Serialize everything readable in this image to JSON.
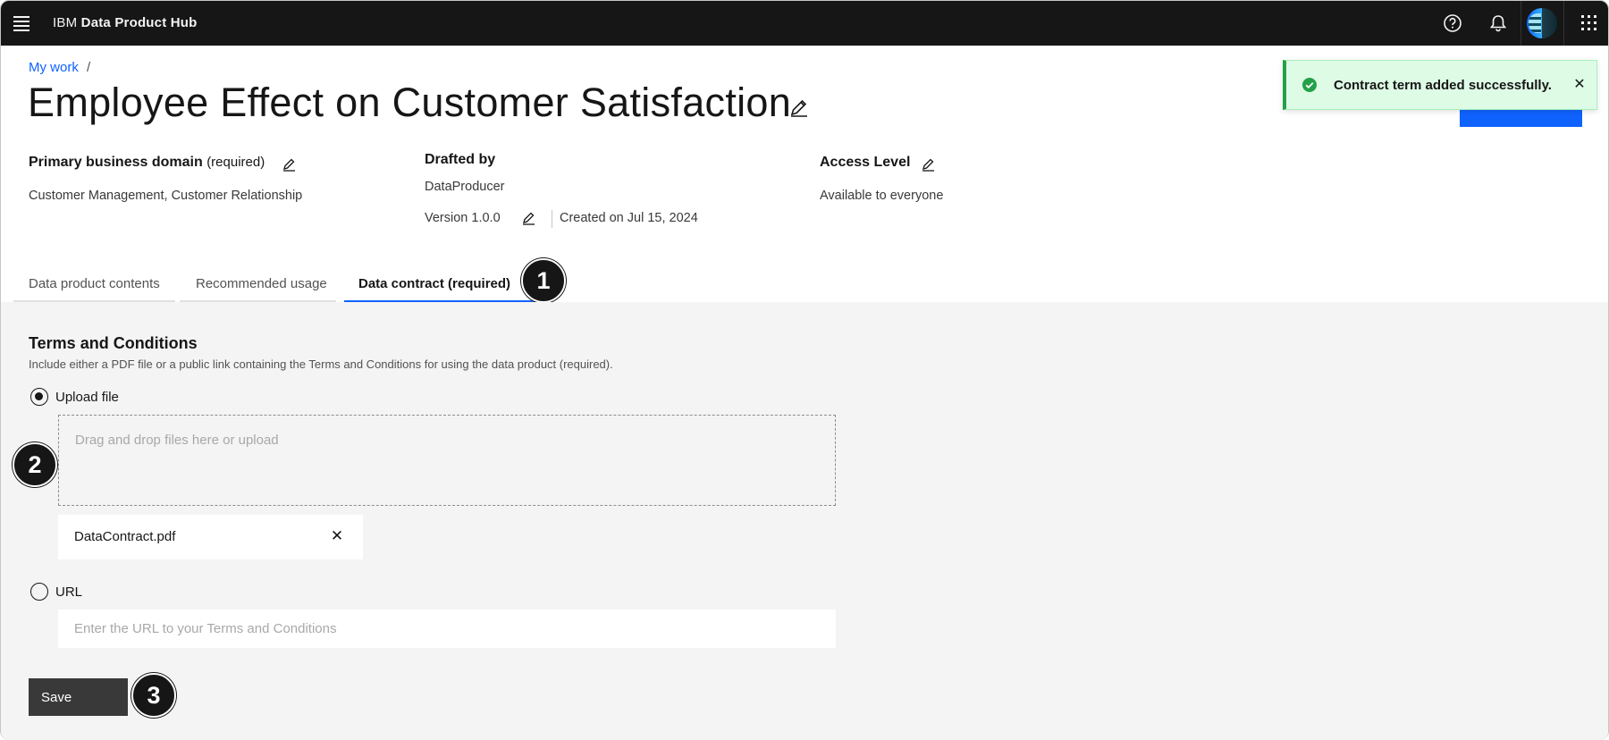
{
  "header": {
    "app_prefix": "IBM",
    "app_name": "Data Product Hub"
  },
  "breadcrumb": {
    "link": "My work",
    "separator": "/"
  },
  "page": {
    "title": "Employee Effect on Customer Satisfaction"
  },
  "toast": {
    "message": "Contract term added successfully.",
    "close": "✕"
  },
  "meta": {
    "domain_label": "Primary business domain",
    "domain_required": "(required)",
    "domain_value": "Customer Management, Customer Relationship",
    "drafted_label": "Drafted by",
    "drafted_value": "DataProducer",
    "version": "Version 1.0.0",
    "created": "Created on Jul 15, 2024",
    "access_label": "Access Level",
    "access_value": "Available to everyone"
  },
  "tabs": [
    {
      "label": "Data product contents"
    },
    {
      "label": "Recommended usage"
    },
    {
      "label": "Data contract (required)",
      "active": true
    }
  ],
  "callouts": [
    "1",
    "2",
    "3"
  ],
  "terms": {
    "title": "Terms and Conditions",
    "description": "Include either a PDF file or a public link containing the Terms and Conditions for using the data product (required).",
    "upload_label": "Upload file",
    "dropzone_text": "Drag and drop files here or upload",
    "file_name": "DataContract.pdf",
    "file_remove": "✕",
    "url_label": "URL",
    "url_placeholder": "Enter the URL to your Terms and Conditions",
    "save_label": "Save"
  },
  "colors": {
    "topbar": "#161616",
    "link": "#0f62fe",
    "toast_bg": "#defbe6",
    "toast_accent": "#24a148",
    "content_bg": "#f4f4f4"
  },
  "icons": [
    "menu-icon",
    "help-icon",
    "bell-icon",
    "switcher-icon",
    "edit-icon",
    "checkmark-filled-icon",
    "close-icon"
  ]
}
